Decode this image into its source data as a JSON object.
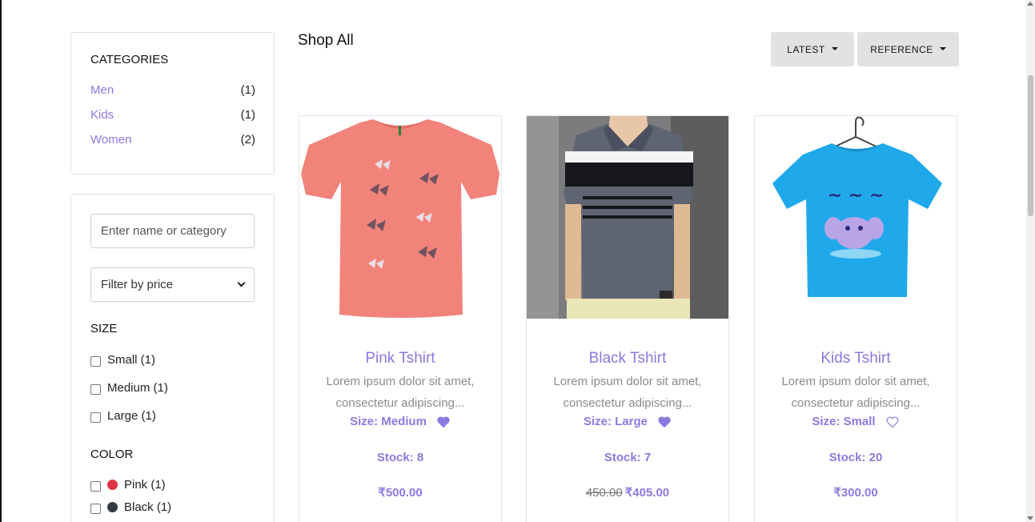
{
  "sidebar": {
    "categories_heading": "CATEGORIES",
    "categories": [
      {
        "label": "Men",
        "count": "(1)"
      },
      {
        "label": "Kids",
        "count": "(1)"
      },
      {
        "label": "Women",
        "count": "(2)"
      }
    ],
    "search": {
      "placeholder": "Enter name or category"
    },
    "price_filter": {
      "selected": "Filter by price"
    },
    "size_heading": "SIZE",
    "sizes": [
      {
        "label": "Small (1)"
      },
      {
        "label": "Medium (1)"
      },
      {
        "label": "Large (1)"
      }
    ],
    "color_heading": "COLOR",
    "colors": [
      {
        "label": "Pink (1)",
        "swatch": "#dc3545"
      },
      {
        "label": "Black (1)",
        "swatch": "#343a40"
      }
    ]
  },
  "main": {
    "title": "Shop All",
    "sort_buttons": [
      {
        "label": "LATEST"
      },
      {
        "label": "REFERENCE"
      }
    ],
    "products": [
      {
        "name": "Pink Tshirt",
        "description": "Lorem ipsum dolor sit amet, consectetur adipiscing...",
        "size": "Size: Medium",
        "favorited": true,
        "stock": "Stock: 8",
        "old_price": "",
        "price": "₹500.00",
        "image_icon": "pink-butterfly-tshirt"
      },
      {
        "name": "Black Tshirt",
        "description": "Lorem ipsum dolor sit amet, consectetur adipiscing...",
        "size": "Size: Large",
        "favorited": true,
        "stock": "Stock: 7",
        "old_price": "450.00",
        "price": "₹405.00",
        "image_icon": "striped-polo-model"
      },
      {
        "name": "Kids Tshirt",
        "description": "Lorem ipsum dolor sit amet, consectetur adipiscing...",
        "size": "Size: Small",
        "favorited": false,
        "stock": "Stock: 20",
        "old_price": "",
        "price": "₹300.00",
        "image_icon": "blue-elephant-tshirt"
      }
    ]
  },
  "colors": {
    "accent": "#8a7ae0",
    "button_bg": "#e2e2e2",
    "border": "#e3e3e3"
  }
}
